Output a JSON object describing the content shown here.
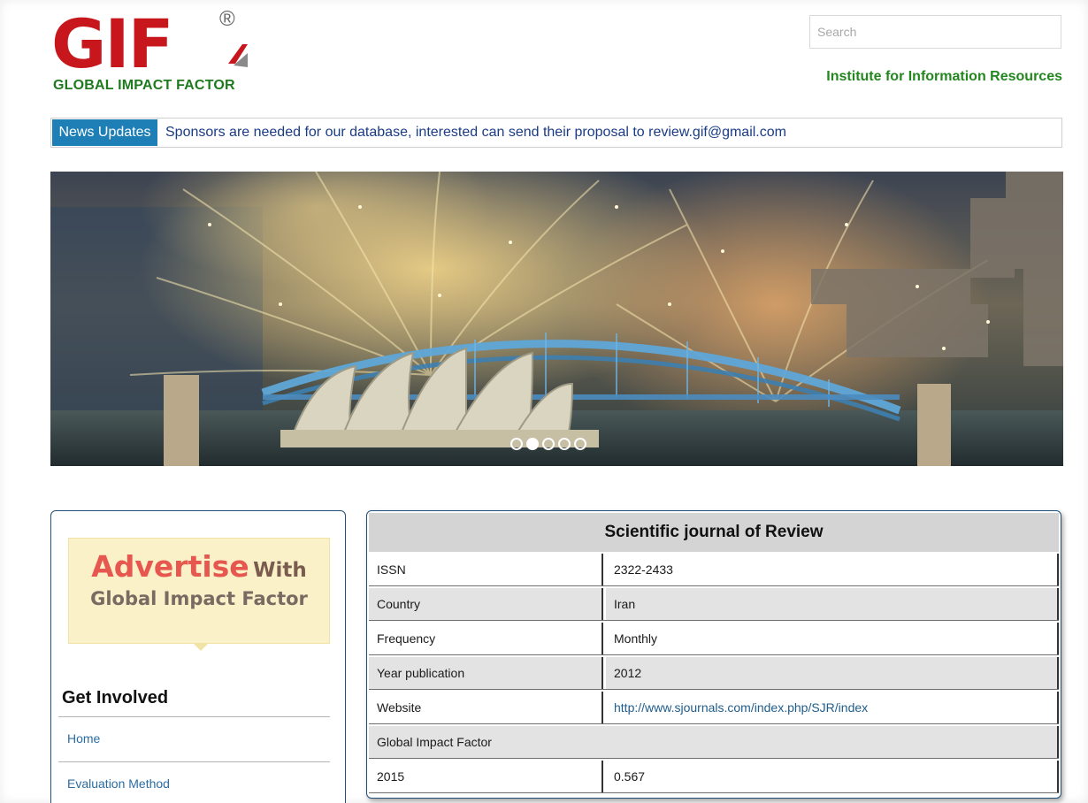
{
  "header": {
    "logo_mark": "GIF",
    "logo_registered": "®",
    "logo_tagline": "GLOBAL IMPACT FACTOR",
    "search_placeholder": "Search",
    "institute": "Institute for Information Resources"
  },
  "news": {
    "label": "News Updates",
    "text": "Sponsors are needed for our database, interested can send their proposal to review.gif@gmail.com"
  },
  "slider": {
    "dot_count": 5,
    "active_index": 1
  },
  "sidebar": {
    "ad": {
      "word1": "Advertise",
      "word2": "With",
      "line2": "Global Impact Factor"
    },
    "get_involved_title": "Get Involved",
    "links": [
      "Home",
      "Evaluation Method"
    ]
  },
  "journal": {
    "title": "Scientific journal of Review",
    "rows": [
      {
        "label": "ISSN",
        "value": "2322-2433"
      },
      {
        "label": "Country",
        "value": "Iran"
      },
      {
        "label": "Frequency",
        "value": "Monthly"
      },
      {
        "label": "Year publication",
        "value": "2012"
      },
      {
        "label": "Website",
        "value": "http://www.sjournals.com/index.php/SJR/index"
      },
      {
        "label": "Global Impact Factor",
        "value": ""
      },
      {
        "label": "2015",
        "value": "0.567"
      }
    ]
  },
  "colors": {
    "logo_red": "#c8171c",
    "logo_green": "#1f7a1f",
    "news_label_bg": "#1e7fb6",
    "news_text": "#1a3b86",
    "link_blue": "#2a6ca3",
    "panel_border": "#1f4f7a"
  }
}
